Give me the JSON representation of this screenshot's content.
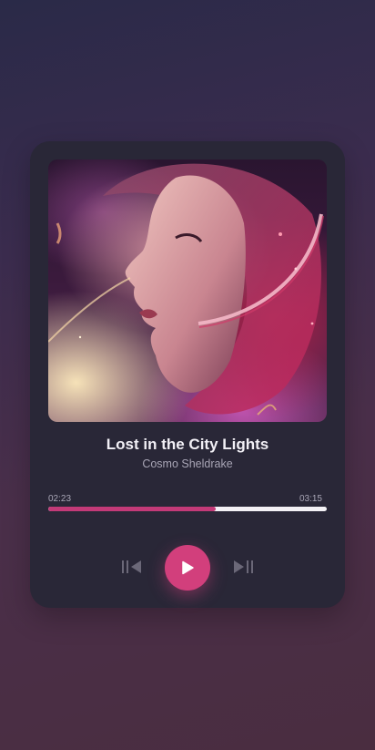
{
  "track": {
    "title": "Lost in the City Lights",
    "artist": "Cosmo Sheldrake"
  },
  "playback": {
    "elapsed": "02:23",
    "duration": "03:15",
    "progress_fraction": 0.6,
    "state": "paused"
  },
  "controls": {
    "previous_icon": "skip-previous-icon",
    "play_icon": "play-icon",
    "next_icon": "skip-next-icon"
  },
  "colors": {
    "background_top": "#2a2a48",
    "background_bottom": "#4a2d40",
    "card": "#292737",
    "accent": "#d23f7c",
    "progress_fill": "#c33a78",
    "progress_track": "#f3f1f5",
    "title_text": "#f2f0f6",
    "muted_text": "#a9a6b6",
    "control_icons": "#6b6878"
  },
  "cover_art": {
    "description_icon": "album-cover-image"
  }
}
